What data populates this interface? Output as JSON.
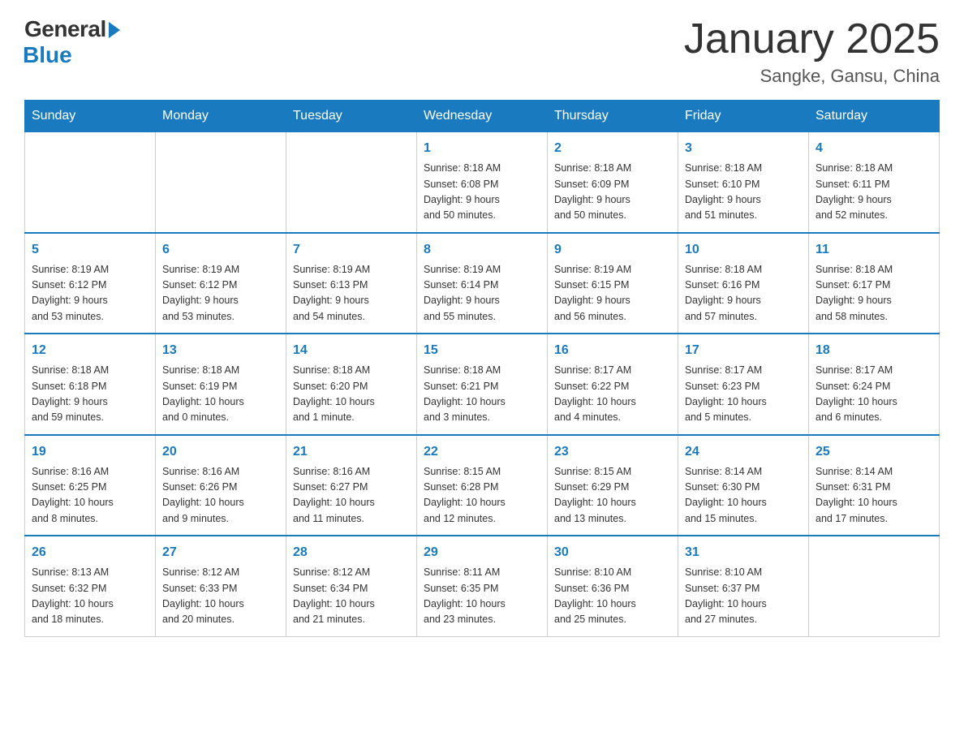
{
  "header": {
    "logo": {
      "general": "General",
      "blue": "Blue"
    },
    "title": "January 2025",
    "subtitle": "Sangke, Gansu, China"
  },
  "days_of_week": [
    "Sunday",
    "Monday",
    "Tuesday",
    "Wednesday",
    "Thursday",
    "Friday",
    "Saturday"
  ],
  "weeks": [
    [
      {
        "day": "",
        "info": ""
      },
      {
        "day": "",
        "info": ""
      },
      {
        "day": "",
        "info": ""
      },
      {
        "day": "1",
        "info": "Sunrise: 8:18 AM\nSunset: 6:08 PM\nDaylight: 9 hours\nand 50 minutes."
      },
      {
        "day": "2",
        "info": "Sunrise: 8:18 AM\nSunset: 6:09 PM\nDaylight: 9 hours\nand 50 minutes."
      },
      {
        "day": "3",
        "info": "Sunrise: 8:18 AM\nSunset: 6:10 PM\nDaylight: 9 hours\nand 51 minutes."
      },
      {
        "day": "4",
        "info": "Sunrise: 8:18 AM\nSunset: 6:11 PM\nDaylight: 9 hours\nand 52 minutes."
      }
    ],
    [
      {
        "day": "5",
        "info": "Sunrise: 8:19 AM\nSunset: 6:12 PM\nDaylight: 9 hours\nand 53 minutes."
      },
      {
        "day": "6",
        "info": "Sunrise: 8:19 AM\nSunset: 6:12 PM\nDaylight: 9 hours\nand 53 minutes."
      },
      {
        "day": "7",
        "info": "Sunrise: 8:19 AM\nSunset: 6:13 PM\nDaylight: 9 hours\nand 54 minutes."
      },
      {
        "day": "8",
        "info": "Sunrise: 8:19 AM\nSunset: 6:14 PM\nDaylight: 9 hours\nand 55 minutes."
      },
      {
        "day": "9",
        "info": "Sunrise: 8:19 AM\nSunset: 6:15 PM\nDaylight: 9 hours\nand 56 minutes."
      },
      {
        "day": "10",
        "info": "Sunrise: 8:18 AM\nSunset: 6:16 PM\nDaylight: 9 hours\nand 57 minutes."
      },
      {
        "day": "11",
        "info": "Sunrise: 8:18 AM\nSunset: 6:17 PM\nDaylight: 9 hours\nand 58 minutes."
      }
    ],
    [
      {
        "day": "12",
        "info": "Sunrise: 8:18 AM\nSunset: 6:18 PM\nDaylight: 9 hours\nand 59 minutes."
      },
      {
        "day": "13",
        "info": "Sunrise: 8:18 AM\nSunset: 6:19 PM\nDaylight: 10 hours\nand 0 minutes."
      },
      {
        "day": "14",
        "info": "Sunrise: 8:18 AM\nSunset: 6:20 PM\nDaylight: 10 hours\nand 1 minute."
      },
      {
        "day": "15",
        "info": "Sunrise: 8:18 AM\nSunset: 6:21 PM\nDaylight: 10 hours\nand 3 minutes."
      },
      {
        "day": "16",
        "info": "Sunrise: 8:17 AM\nSunset: 6:22 PM\nDaylight: 10 hours\nand 4 minutes."
      },
      {
        "day": "17",
        "info": "Sunrise: 8:17 AM\nSunset: 6:23 PM\nDaylight: 10 hours\nand 5 minutes."
      },
      {
        "day": "18",
        "info": "Sunrise: 8:17 AM\nSunset: 6:24 PM\nDaylight: 10 hours\nand 6 minutes."
      }
    ],
    [
      {
        "day": "19",
        "info": "Sunrise: 8:16 AM\nSunset: 6:25 PM\nDaylight: 10 hours\nand 8 minutes."
      },
      {
        "day": "20",
        "info": "Sunrise: 8:16 AM\nSunset: 6:26 PM\nDaylight: 10 hours\nand 9 minutes."
      },
      {
        "day": "21",
        "info": "Sunrise: 8:16 AM\nSunset: 6:27 PM\nDaylight: 10 hours\nand 11 minutes."
      },
      {
        "day": "22",
        "info": "Sunrise: 8:15 AM\nSunset: 6:28 PM\nDaylight: 10 hours\nand 12 minutes."
      },
      {
        "day": "23",
        "info": "Sunrise: 8:15 AM\nSunset: 6:29 PM\nDaylight: 10 hours\nand 13 minutes."
      },
      {
        "day": "24",
        "info": "Sunrise: 8:14 AM\nSunset: 6:30 PM\nDaylight: 10 hours\nand 15 minutes."
      },
      {
        "day": "25",
        "info": "Sunrise: 8:14 AM\nSunset: 6:31 PM\nDaylight: 10 hours\nand 17 minutes."
      }
    ],
    [
      {
        "day": "26",
        "info": "Sunrise: 8:13 AM\nSunset: 6:32 PM\nDaylight: 10 hours\nand 18 minutes."
      },
      {
        "day": "27",
        "info": "Sunrise: 8:12 AM\nSunset: 6:33 PM\nDaylight: 10 hours\nand 20 minutes."
      },
      {
        "day": "28",
        "info": "Sunrise: 8:12 AM\nSunset: 6:34 PM\nDaylight: 10 hours\nand 21 minutes."
      },
      {
        "day": "29",
        "info": "Sunrise: 8:11 AM\nSunset: 6:35 PM\nDaylight: 10 hours\nand 23 minutes."
      },
      {
        "day": "30",
        "info": "Sunrise: 8:10 AM\nSunset: 6:36 PM\nDaylight: 10 hours\nand 25 minutes."
      },
      {
        "day": "31",
        "info": "Sunrise: 8:10 AM\nSunset: 6:37 PM\nDaylight: 10 hours\nand 27 minutes."
      },
      {
        "day": "",
        "info": ""
      }
    ]
  ]
}
